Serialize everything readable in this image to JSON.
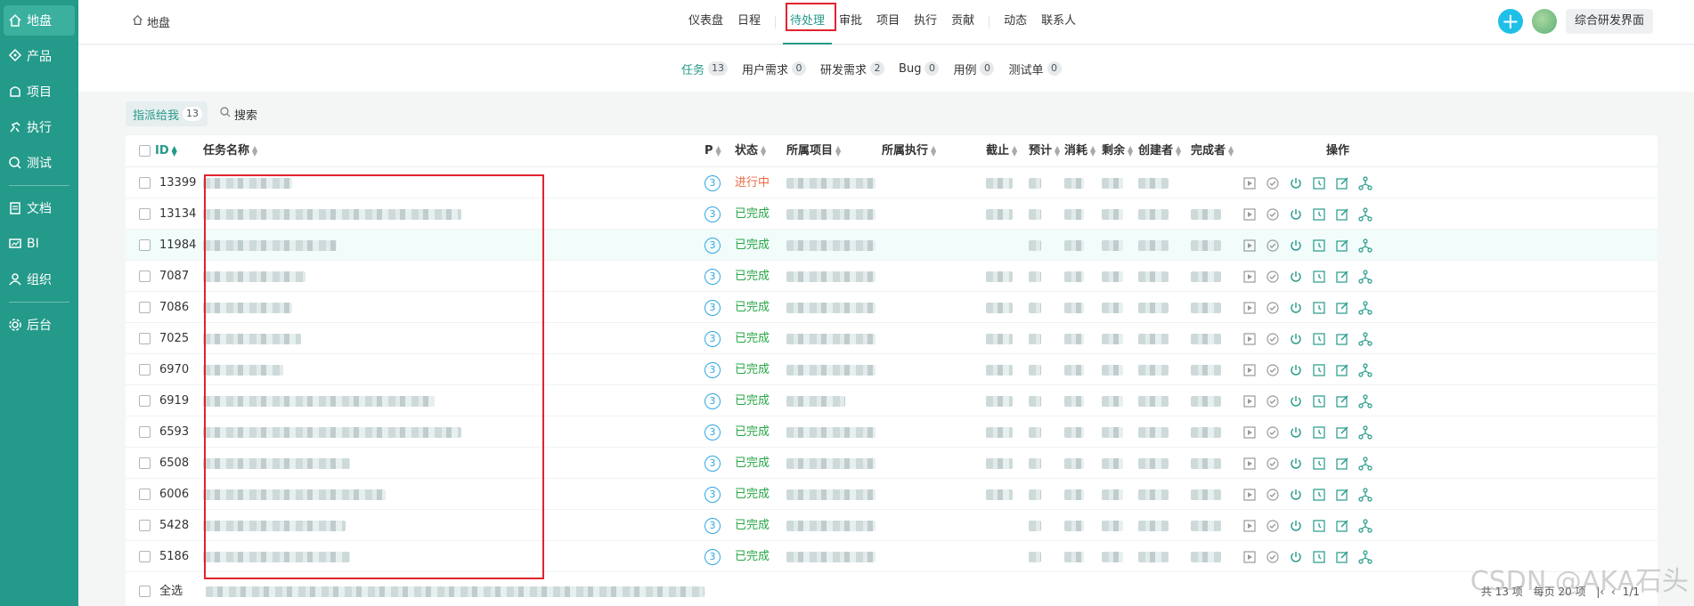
{
  "sidebar": {
    "items": [
      {
        "label": "地盘",
        "icon": "home-icon",
        "active": true
      },
      {
        "label": "产品",
        "icon": "product-icon"
      },
      {
        "label": "项目",
        "icon": "project-icon"
      },
      {
        "label": "执行",
        "icon": "run-icon"
      },
      {
        "label": "测试",
        "icon": "test-icon"
      },
      {
        "label": "文档",
        "icon": "doc-icon"
      },
      {
        "label": "BI",
        "icon": "bi-icon"
      },
      {
        "label": "组织",
        "icon": "org-icon"
      },
      {
        "label": "后台",
        "icon": "gear-icon"
      }
    ]
  },
  "breadcrumb": {
    "label": "地盘"
  },
  "mainnav": {
    "items": [
      "仪表盘",
      "日程",
      "待处理",
      "审批",
      "项目",
      "执行",
      "贡献",
      "动态",
      "联系人"
    ],
    "active": "待处理"
  },
  "topright": {
    "switch_label": "综合研发界面"
  },
  "subnav": {
    "items": [
      {
        "label": "任务",
        "count": "13"
      },
      {
        "label": "用户需求",
        "count": "0"
      },
      {
        "label": "研发需求",
        "count": "2"
      },
      {
        "label": "Bug",
        "count": "0"
      },
      {
        "label": "用例",
        "count": "0"
      },
      {
        "label": "测试单",
        "count": "0"
      }
    ]
  },
  "filter": {
    "chip_label": "指派给我",
    "chip_count": "13",
    "search_label": "搜索"
  },
  "table": {
    "headers": {
      "id": "ID",
      "name": "任务名称",
      "pri": "P",
      "status": "状态",
      "project": "所属项目",
      "execution": "所属执行",
      "deadline": "截止",
      "estimate": "预计",
      "consumed": "消耗",
      "left": "剩余",
      "creator": "创建者",
      "finisher": "完成者",
      "actions": "操作"
    },
    "rows": [
      {
        "id": "13399",
        "pri": "3",
        "status": "进行中"
      },
      {
        "id": "13134",
        "pri": "3",
        "status": "已完成"
      },
      {
        "id": "11984",
        "pri": "3",
        "status": "已完成"
      },
      {
        "id": "7087",
        "pri": "3",
        "status": "已完成"
      },
      {
        "id": "7086",
        "pri": "3",
        "status": "已完成"
      },
      {
        "id": "7025",
        "pri": "3",
        "status": "已完成"
      },
      {
        "id": "6970",
        "pri": "3",
        "status": "已完成"
      },
      {
        "id": "6919",
        "pri": "3",
        "status": "已完成"
      },
      {
        "id": "6593",
        "pri": "3",
        "status": "已完成"
      },
      {
        "id": "6508",
        "pri": "3",
        "status": "已完成"
      },
      {
        "id": "6006",
        "pri": "3",
        "status": "已完成"
      },
      {
        "id": "5428",
        "pri": "3",
        "status": "已完成"
      },
      {
        "id": "5186",
        "pri": "3",
        "status": "已完成"
      }
    ]
  },
  "footer": {
    "select_all": "全选",
    "total": "共 13 项",
    "per_page": "每页 20 项",
    "page": "1/1"
  },
  "watermark": "CSDN @AKA石头",
  "colors": {
    "brand": "#249a8a",
    "highlight": "#e0242f",
    "done": "#27a644",
    "doing": "#ec6a44",
    "plus": "#1fc0e8"
  }
}
